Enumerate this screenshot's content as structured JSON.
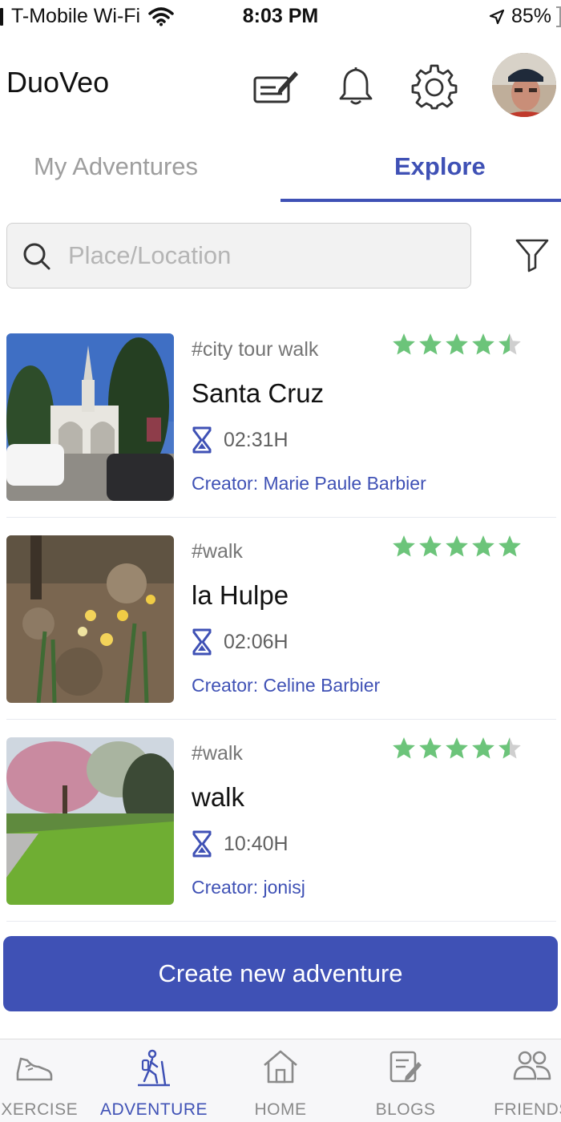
{
  "status_bar": {
    "carrier": "T-Mobile Wi-Fi",
    "time": "8:03 PM",
    "battery": "85%"
  },
  "header": {
    "app_title": "DuoVeo",
    "icons": [
      "edit-note-icon",
      "bell-icon",
      "gear-icon",
      "avatar"
    ]
  },
  "tabs": [
    {
      "label": "My Adventures",
      "active": false
    },
    {
      "label": "Explore",
      "active": true
    }
  ],
  "search": {
    "placeholder": "Place/Location",
    "value": ""
  },
  "adventures": [
    {
      "tag": "#city tour walk",
      "title": "Santa Cruz",
      "duration": "02:31H",
      "creator": "Creator: Marie Paule Barbier",
      "rating": 4.5
    },
    {
      "tag": "#walk",
      "title": "la Hulpe",
      "duration": "02:06H",
      "creator": "Creator: Celine Barbier",
      "rating": 5
    },
    {
      "tag": "#walk",
      "title": "walk",
      "duration": "10:40H",
      "creator": "Creator: jonisj",
      "rating": 4.5
    }
  ],
  "create_button": "Create new adventure",
  "bottom_nav": [
    {
      "label": "EXERCISE",
      "icon": "shoe-icon",
      "active": false
    },
    {
      "label": "ADVENTURE",
      "icon": "hiker-icon",
      "active": true
    },
    {
      "label": "HOME",
      "icon": "home-icon",
      "active": false
    },
    {
      "label": "BLOGS",
      "icon": "blog-edit-icon",
      "active": false
    },
    {
      "label": "FRIENDS",
      "icon": "friends-icon",
      "active": false
    }
  ],
  "colors": {
    "accent": "#3f51b5",
    "star": "#6cc47a",
    "star_empty": "#cfcfcf"
  }
}
